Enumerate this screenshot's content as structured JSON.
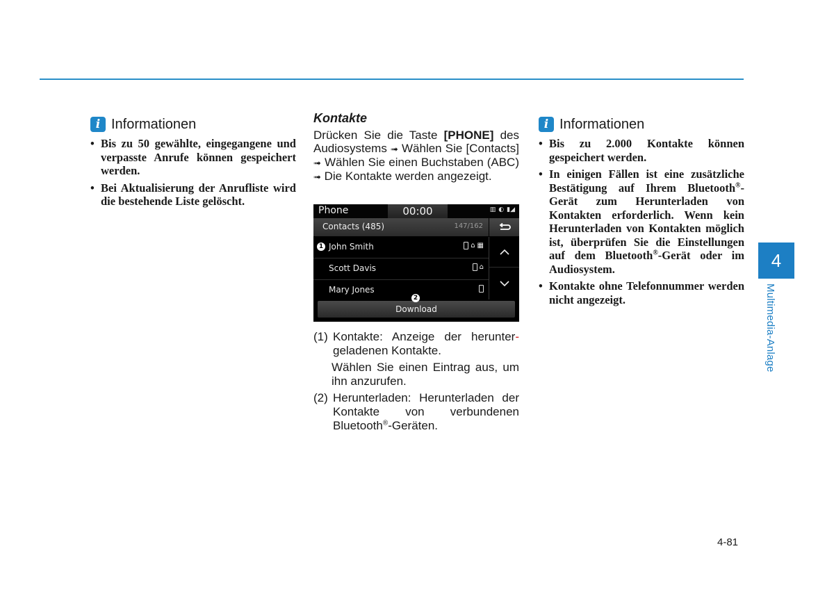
{
  "header": {
    "rule_color": "#2a8fc8"
  },
  "left_info": {
    "icon": "info-icon",
    "title": "Informationen",
    "bullets": [
      "Bis zu 50 gewählte, eingegangene und verpasste Anrufe können gespeichert werden.",
      "Bei Aktualisierung der Anrufliste wird die bestehende Liste gelöscht."
    ]
  },
  "middle": {
    "heading": "Kontakte",
    "intro": {
      "p1": "Drücken Sie die Taste ",
      "key": "[PHONE]",
      "p2": " des Audiosystems ",
      "arrow": "➟",
      "p3": " Wählen Sie [Contacts] ",
      "p4": " Wählen Sie einen Buchstaben (ABC) ",
      "p5": " Die Kontakte werden angezeigt."
    },
    "screen": {
      "status_title": "Phone",
      "clock": "00:00",
      "status_icons": [
        "battery-icon",
        "bluetooth-audio-icon",
        "signal-icon"
      ],
      "list_title": "Contacts (485)",
      "list_count": "147/162",
      "back_icon": "back-icon",
      "contacts": [
        {
          "name": "John Smith",
          "icons": [
            "mobile-icon",
            "home-icon",
            "office-icon"
          ]
        },
        {
          "name": "Scott Davis",
          "icons": [
            "mobile-icon",
            "home-icon"
          ]
        },
        {
          "name": "Mary Jones",
          "icons": [
            "mobile-icon"
          ]
        }
      ],
      "scroll_up_icon": "chevron-up-icon",
      "scroll_down_icon": "chevron-down-icon",
      "download_label": "Download",
      "callout_1": "1",
      "callout_2": "2"
    },
    "numbered": [
      {
        "num": "(1)",
        "text_a": "Kontakte: Anzeige der herunter",
        "hyphen": "-",
        "text_b": "geladenen Kontakte.",
        "para": "Wählen Sie einen Eintrag aus, um ihn anzurufen."
      },
      {
        "num": "(2)",
        "text_a": "Herunterladen: Herunterladen der Kontakte von verbundenen Bluetooth",
        "reg": "®",
        "text_b": "-Geräten."
      }
    ]
  },
  "right_info": {
    "icon": "info-icon",
    "title": "Informationen",
    "bullets": [
      {
        "text": "Bis zu 2.000 Kontakte können gespeichert werden."
      },
      {
        "a": "In einigen Fällen ist eine zusätzliche Bestätigung auf Ihrem Bluetooth",
        "reg": "®",
        "b": "-Gerät zum Herunterladen von Kontakten erforderlich. Wenn kein Herunterladen von Kontakten möglich ist, überprüfen Sie die Einstellungen auf dem Bluetooth",
        "reg2": "®",
        "c": "-Gerät oder im Audiosystem."
      },
      {
        "text": "Kontakte ohne Telefonnummer werden nicht angezeigt."
      }
    ]
  },
  "chapter": {
    "number": "4",
    "label": "Multimedia-Anlage",
    "color": "#1d7fc4"
  },
  "page_number": "4-81"
}
